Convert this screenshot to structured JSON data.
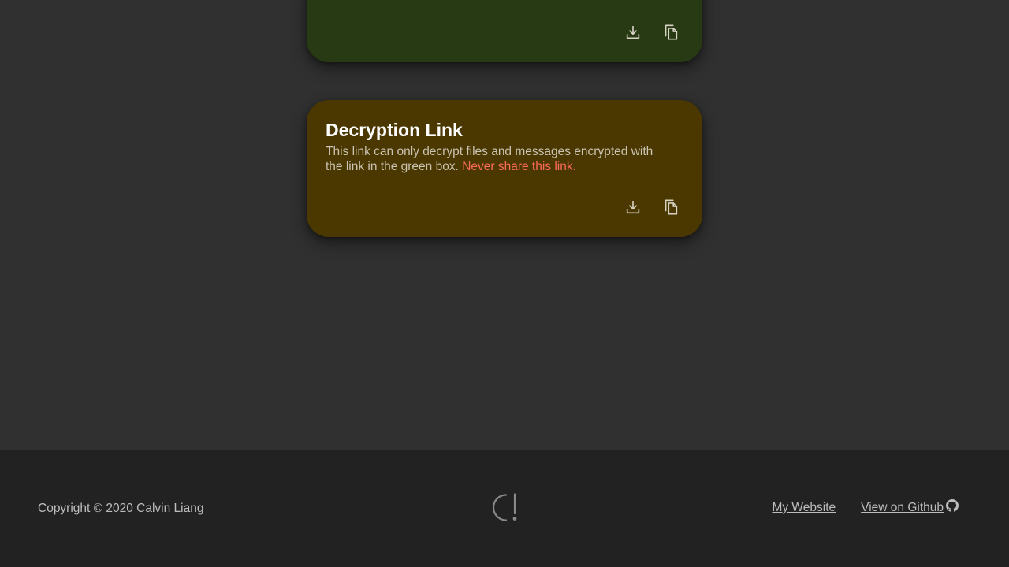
{
  "encryption_card": {
    "download_icon": "download-icon",
    "copy_icon": "copy-icon"
  },
  "decryption_card": {
    "title": "Decryption Link",
    "description": "This link can only decrypt files and messages encrypted with the link in the green box.",
    "warning": "Never share this link.",
    "download_icon": "download-icon",
    "copy_icon": "copy-icon"
  },
  "footer": {
    "copyright": "Copyright © 2020 Calvin Liang",
    "logo_icon": "c-exclamation-logo",
    "links": {
      "website": "My Website",
      "github": "View on Github"
    },
    "github_icon": "github-icon"
  },
  "colors": {
    "background": "#303030",
    "footer_background": "#222222",
    "green_card": "#283a14",
    "orange_card": "#4a3800",
    "warning_text": "#ff6b5b"
  }
}
